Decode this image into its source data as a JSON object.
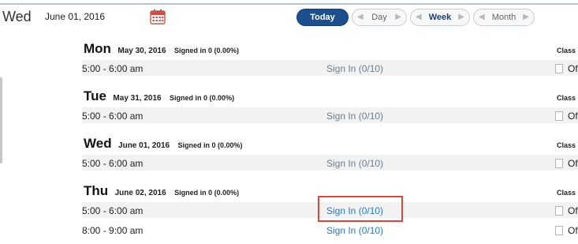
{
  "header": {
    "day": "Wed",
    "date": "June 01, 2016",
    "calendar_icon": "calendar-icon",
    "buttons": {
      "today": "Today",
      "day": "Day",
      "week": "Week",
      "month": "Month"
    }
  },
  "class_header": "Class",
  "days": [
    {
      "name": "Mon",
      "date": "May 30, 2016",
      "signed": "Signed in 0 (0.00%)",
      "sessions": [
        {
          "time": "5:00 - 6:00 am",
          "sign_in": "Sign In (0/10)",
          "class_value": "Of"
        }
      ]
    },
    {
      "name": "Tue",
      "date": "May 31, 2016",
      "signed": "Signed in 0 (0.00%)",
      "sessions": [
        {
          "time": "5:00 - 6:00 am",
          "sign_in": "Sign In (0/10)",
          "class_value": "Of"
        }
      ]
    },
    {
      "name": "Wed",
      "date": "June 01, 2016",
      "signed": "Signed in 0 (0.00%)",
      "sessions": [
        {
          "time": "5:00 - 6:00 am",
          "sign_in": "Sign In (0/10)",
          "class_value": "Of"
        }
      ]
    },
    {
      "name": "Thu",
      "date": "June 02, 2016",
      "signed": "Signed in 0 (0.00%)",
      "sessions": [
        {
          "time": "5:00 - 6:00 am",
          "sign_in": "Sign In (0/10)",
          "class_value": "Of"
        },
        {
          "time": "8:00 - 9:00 am",
          "sign_in": "Sign In (0/10)",
          "class_value": "Of"
        }
      ]
    }
  ],
  "colors": {
    "today_button": "#1d4f8e",
    "active_link": "#2b79c2",
    "inactive_link": "#6c7d8c",
    "highlight_box": "#d9473f"
  }
}
